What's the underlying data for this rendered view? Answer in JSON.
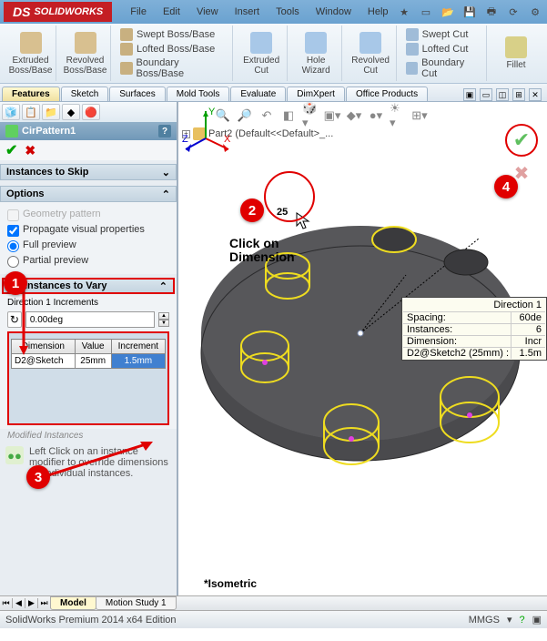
{
  "app": {
    "name": "SOLIDWORKS"
  },
  "menus": {
    "file": "File",
    "edit": "Edit",
    "view": "View",
    "insert": "Insert",
    "tools": "Tools",
    "window": "Window",
    "help": "Help"
  },
  "ribbon": {
    "extrudedBoss": "Extruded\nBoss/Base",
    "revolvedBoss": "Revolved\nBoss/Base",
    "sweptBoss": "Swept Boss/Base",
    "loftedBoss": "Lofted Boss/Base",
    "boundaryBoss": "Boundary Boss/Base",
    "extrudedCut": "Extruded\nCut",
    "holeWizard": "Hole\nWizard",
    "revolvedCut": "Revolved\nCut",
    "sweptCut": "Swept Cut",
    "loftedCut": "Lofted Cut",
    "boundaryCut": "Boundary Cut",
    "fillet": "Fillet"
  },
  "cmdTabs": {
    "features": "Features",
    "sketch": "Sketch",
    "surfaces": "Surfaces",
    "moldTools": "Mold Tools",
    "evaluate": "Evaluate",
    "dimxpert": "DimXpert",
    "office": "Office Products"
  },
  "pm": {
    "title": "CirPattern1",
    "skipHeader": "Instances to Skip",
    "optionsHeader": "Options",
    "geometryPattern": "Geometry pattern",
    "propagate": "Propagate visual properties",
    "fullPreview": "Full preview",
    "partialPreview": "Partial preview",
    "varyHeader": "Instances to Vary",
    "dir1Label": "Direction 1 Increments",
    "angleValue": "0.00deg",
    "col1": "Dimension",
    "col2": "Value",
    "col3": "Increment",
    "cellDim": "D2@Sketch",
    "cellVal": "25mm",
    "cellInc": "1.5mm",
    "modifiedLabel": "Modified Instances",
    "instructions": "Left Click on an instance modifier to override dimensions for individual instances."
  },
  "gfx": {
    "partName": "Part2  (Default<<Default>_...",
    "annotation": "Click on\nDimension",
    "dimValue": "25",
    "isoLabel": "*Isometric",
    "callout": {
      "title": "Direction 1",
      "spacing": "Spacing:",
      "spacingVal": "60de",
      "instances": "Instances:",
      "instancesVal": "6",
      "dimension": "Dimension:",
      "dimensionVal": "Incr",
      "dimRef": "D2@Sketch2 (25mm) :",
      "dimRefVal": "1.5m"
    }
  },
  "bottomTabs": {
    "model": "Model",
    "motion": "Motion Study 1"
  },
  "status": {
    "text": "SolidWorks Premium 2014 x64 Edition",
    "units": "MMGS"
  },
  "badges": {
    "b1": "1",
    "b2": "2",
    "b3": "3",
    "b4": "4"
  }
}
